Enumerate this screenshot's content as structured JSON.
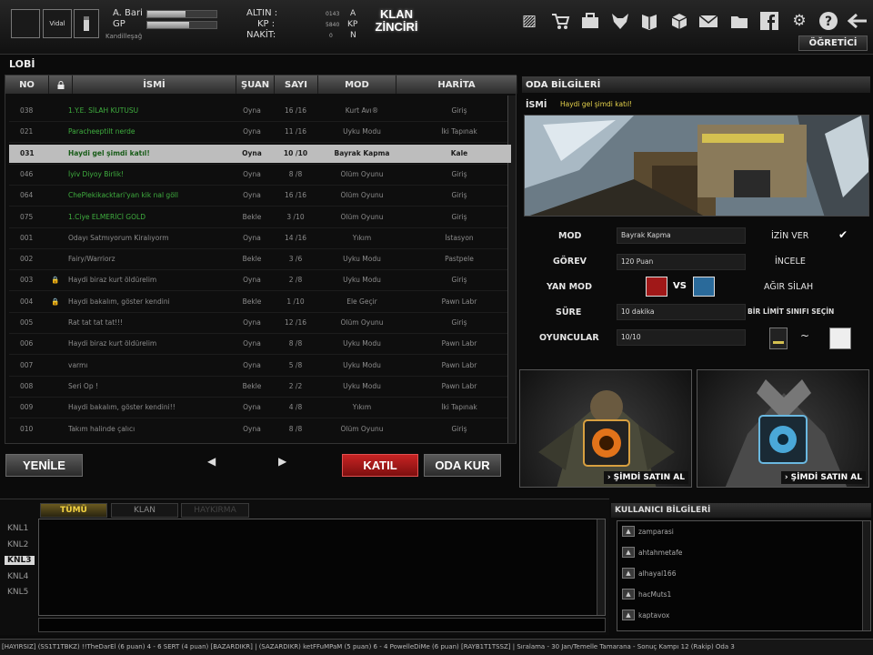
{
  "player": {
    "square_badge": "Vidal",
    "name": "A. Bari",
    "gp_label": "GP",
    "sub_label": "Kandilleşağ",
    "exp_fill": 0.55,
    "gp_fill": 0.6
  },
  "currency": {
    "altin": "ALTIN :",
    "kp": "KP :",
    "nakit": "NAKİT:",
    "mini_values": [
      "0143",
      "5840",
      "0"
    ],
    "mini_labels": [
      "A",
      "KP",
      "N"
    ]
  },
  "klan_button": {
    "line1": "KLAN",
    "line2": "ZİNCİRİ"
  },
  "top_icons": [
    "image-icon",
    "cart-icon",
    "bag-icon",
    "wolf-icon",
    "book-icon",
    "box-icon",
    "mail-icon",
    "folder-icon",
    "facebook-icon",
    "gear-icon",
    "help-icon",
    "back-arrow-icon"
  ],
  "ogretici": "ÖĞRETİCİ",
  "lobi": {
    "title": "LOBİ",
    "columns": [
      "NO",
      "🔒",
      "İSMİ",
      "ŞUAN",
      "SAYI",
      "MOD",
      "HARİTA"
    ],
    "rows": [
      {
        "no": "038",
        "lock": "",
        "name": "1.Y.E. SİLAH KUTUSU",
        "status": "Oyna",
        "count": "16 /16",
        "mode": "Kurt Avı®",
        "map": "Giriş",
        "green": true,
        "selected": false
      },
      {
        "no": "021",
        "lock": "",
        "name": "Paracheeptilt nerde",
        "status": "Oyna",
        "count": "11 /16",
        "mode": "Uyku Modu",
        "map": "İki Tapınak",
        "green": true,
        "selected": false
      },
      {
        "no": "031",
        "lock": "",
        "name": "Haydi gel şimdi katıl!",
        "status": "Oyna",
        "count": "10 /10",
        "mode": "Bayrak Kapma",
        "map": "Kale",
        "green": true,
        "selected": true
      },
      {
        "no": "046",
        "lock": "",
        "name": "İyiv Diyoy Birlik!",
        "status": "Oyna",
        "count": "8 /8",
        "mode": "Ölüm Oyunu",
        "map": "Giriş",
        "green": true,
        "selected": false
      },
      {
        "no": "064",
        "lock": "",
        "name": "ChePlekikacktari'yan kik nal göll",
        "status": "Oyna",
        "count": "16 /16",
        "mode": "Ölüm Oyunu",
        "map": "Giriş",
        "green": true,
        "selected": false
      },
      {
        "no": "075",
        "lock": "",
        "name": "1.Ciye ELMERİCİ GOLD",
        "status": "Bekle",
        "count": "3 /10",
        "mode": "Ölüm Oyunu",
        "map": "Giriş",
        "green": true,
        "selected": false
      },
      {
        "no": "001",
        "lock": "",
        "name": "Odayı Satmıyorum Kiralıyorm",
        "status": "Oyna",
        "count": "14 /16",
        "mode": "Yıkım",
        "map": "İstasyon",
        "green": false,
        "selected": false
      },
      {
        "no": "002",
        "lock": "",
        "name": "Fairy/Warriorz",
        "status": "Bekle",
        "count": "3 /6",
        "mode": "Uyku Modu",
        "map": "Pastpele",
        "green": false,
        "selected": false
      },
      {
        "no": "003",
        "lock": "🔒",
        "name": "Haydi biraz kurt öldürelim",
        "status": "Oyna",
        "count": "2 /8",
        "mode": "Uyku Modu",
        "map": "Giriş",
        "green": false,
        "selected": false
      },
      {
        "no": "004",
        "lock": "🔒",
        "name": "Haydi bakalım, göster kendini",
        "status": "Bekle",
        "count": "1 /10",
        "mode": "Ele Geçir",
        "map": "Pawn Labr",
        "green": false,
        "selected": false
      },
      {
        "no": "005",
        "lock": "",
        "name": "Rat tat tat tat!!!",
        "status": "Oyna",
        "count": "12 /16",
        "mode": "Ölüm Oyunu",
        "map": "Giriş",
        "green": false,
        "selected": false
      },
      {
        "no": "006",
        "lock": "",
        "name": "Haydi biraz kurt öldürelim",
        "status": "Oyna",
        "count": "8 /8",
        "mode": "Uyku Modu",
        "map": "Pawn Labr",
        "green": false,
        "selected": false
      },
      {
        "no": "007",
        "lock": "",
        "name": "varmı",
        "status": "Oyna",
        "count": "5 /8",
        "mode": "Uyku Modu",
        "map": "Pawn Labr",
        "green": false,
        "selected": false
      },
      {
        "no": "008",
        "lock": "",
        "name": "Seri Op !",
        "status": "Bekle",
        "count": "2 /2",
        "mode": "Uyku Modu",
        "map": "Pawn Labr",
        "green": false,
        "selected": false
      },
      {
        "no": "009",
        "lock": "",
        "name": "Haydi bakalım, göster kendini!!",
        "status": "Oyna",
        "count": "4 /8",
        "mode": "Yıkım",
        "map": "İki Tapınak",
        "green": false,
        "selected": false
      },
      {
        "no": "010",
        "lock": "",
        "name": "Takım halinde çalıcı",
        "status": "Oyna",
        "count": "8 /8",
        "mode": "Ölüm Oyunu",
        "map": "Giriş",
        "green": false,
        "selected": false
      }
    ],
    "buttons": {
      "refresh": "YENİLE",
      "prev": "◀",
      "next": "▶",
      "join": "KATIL",
      "create": "ODA KUR"
    }
  },
  "oda": {
    "title": "ODA BİLGİLERİ",
    "name_label": "İSMİ",
    "name_value": "Haydi gel şimdi katıl!",
    "labels": [
      "MOD",
      "GÖREV",
      "YAN MOD",
      "SÜRE",
      "OYUNCULAR"
    ],
    "mod_value": "Bayrak Kapma",
    "gorev_value": "120 Puan",
    "vs_label": "VS",
    "sure_value": "10 dakika",
    "oyuncular_value": "10/10",
    "izin_ver": "İZİN VER",
    "incele": "İNCELE",
    "agir_silah": "AĞIR SİLAH",
    "rank_limit": "BİR LİMİT SINIFI SEÇİN",
    "tilde": "~",
    "promo_label": "› ŞİMDİ SATIN AL"
  },
  "chat": {
    "tabs": [
      "TÜMÜ",
      "KLAN",
      "HAYKIRMA"
    ],
    "channels": [
      "KNL1",
      "KNL2",
      "KNL3",
      "KNL4",
      "KNL5"
    ],
    "active_channel_index": 2
  },
  "users": {
    "title": "KULLANICI BİLGİLERİ",
    "list": [
      "zamparasi",
      "ahtahmetafe",
      "alhayal166",
      "hacMuts1",
      "kaptavox"
    ]
  },
  "ticker": "[HAYIRSIZ] (SS1T1TBKZ) !!TheDarEl (6 puan) 4 - 6 SERT (4 puan) [BAZARDIKR] | (SAZARDIKR) ketFFuMPaM (5 puan) 6 - 4 PowelleDiMe (6 puan) [RAYB1T1TSSZ] | Sıralama - 30 Jan/Temelle Tamarana - Sonuç Kampı 12 (Rakip) Oda 3"
}
